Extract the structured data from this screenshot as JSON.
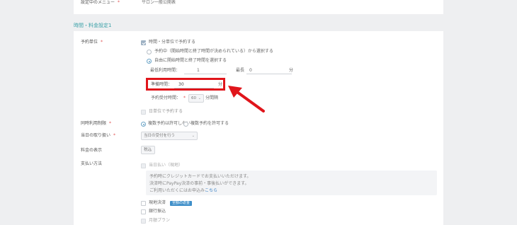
{
  "top": {
    "menu_label": "設定中のメニュー",
    "menu_value": "サロン一般公開表"
  },
  "section": {
    "title": "時間・料金設定1"
  },
  "reservation_unit": {
    "label": "予約単位",
    "checkbox_label": "時間・分単位で予約する",
    "option1": "予約中（開始時間と終了時間が決められている）から選択する",
    "option2": "自由に開始時間と終了時間を選択する",
    "min_time_label": "最低利用時間：",
    "min_time_value": "1",
    "max_time_label": "最長",
    "max_time_value": "0",
    "min_unit": "分",
    "interval_label": "準備時間：",
    "interval_value": "30",
    "interval_unit": "分",
    "start_label": "予約受付時間：",
    "start_value": "60",
    "start_unit": "分間隔",
    "day_unit_label": "日単位で予約する"
  },
  "simultaneous": {
    "label": "同時利用制限",
    "opt_off": "複数予約は許可しない",
    "opt_on": "複数予約を許可する"
  },
  "sameday": {
    "label": "当日の取り扱い",
    "value": "当日の受付を行う"
  },
  "fee_display": {
    "label": "料金の表示",
    "value": "税込"
  },
  "payment": {
    "label": "支払い方法",
    "onsite_label": "当日払い（現地）",
    "note_line1": "予約時にクレジットカードでお支払いいただけます。",
    "note_line2": "決済時にPayPay決済の事前・事後払いができます。",
    "note_line3_prefix": "ご利用いただくにはお申込み",
    "note_line3_link": "こちら",
    "cash_label": "現地決済",
    "cash_badge": "全額の返金",
    "bank_label": "銀行振込",
    "other_label": "月額プラン"
  },
  "colors": {
    "accent": "#3ba1a8",
    "highlight": "#e0151b",
    "required": "#e05353"
  }
}
